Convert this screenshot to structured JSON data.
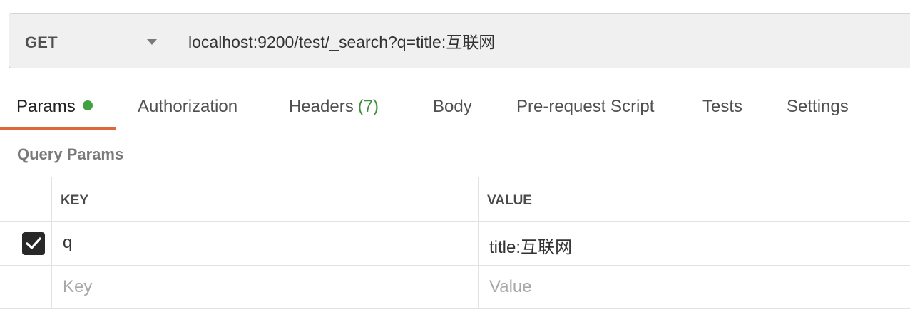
{
  "request": {
    "method": "GET",
    "url": "localhost:9200/test/_search?q=title:互联网"
  },
  "tabs": [
    {
      "label": "Params",
      "active": true,
      "dot": true
    },
    {
      "label": "Authorization"
    },
    {
      "label": "Headers",
      "count": "(7)"
    },
    {
      "label": "Body"
    },
    {
      "label": "Pre-request Script"
    },
    {
      "label": "Tests"
    },
    {
      "label": "Settings"
    }
  ],
  "query_params": {
    "title": "Query Params",
    "columns": {
      "key": "KEY",
      "value": "VALUE"
    },
    "rows": [
      {
        "checked": true,
        "key": "q",
        "value": "title:互联网"
      }
    ],
    "new_row": {
      "key_placeholder": "Key",
      "value_placeholder": "Value"
    }
  },
  "colors": {
    "active_tab_underline": "#e0673a",
    "params_dot": "#3fa142",
    "headers_count": "#3f8f3f"
  },
  "icons": {
    "method_dropdown": "chevron-down-icon",
    "row_checkbox": "check-icon"
  }
}
